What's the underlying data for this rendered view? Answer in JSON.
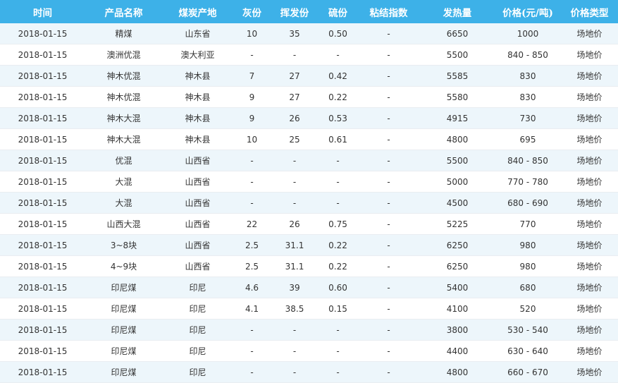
{
  "headers": [
    "时间",
    "产品名称",
    "煤炭产地",
    "灰份",
    "挥发份",
    "硫份",
    "粘结指数",
    "发热量",
    "价格(元/吨)",
    "价格类型"
  ],
  "rows": [
    [
      "2018-01-15",
      "精煤",
      "山东省",
      "10",
      "35",
      "0.50",
      "-",
      "6650",
      "1000",
      "场地价"
    ],
    [
      "2018-01-15",
      "澳洲优混",
      "澳大利亚",
      "-",
      "-",
      "-",
      "-",
      "5500",
      "840 - 850",
      "场地价"
    ],
    [
      "2018-01-15",
      "神木优混",
      "神木县",
      "7",
      "27",
      "0.42",
      "-",
      "5585",
      "830",
      "场地价"
    ],
    [
      "2018-01-15",
      "神木优混",
      "神木县",
      "9",
      "27",
      "0.22",
      "-",
      "5580",
      "830",
      "场地价"
    ],
    [
      "2018-01-15",
      "神木大混",
      "神木县",
      "9",
      "26",
      "0.53",
      "-",
      "4915",
      "730",
      "场地价"
    ],
    [
      "2018-01-15",
      "神木大混",
      "神木县",
      "10",
      "25",
      "0.61",
      "-",
      "4800",
      "695",
      "场地价"
    ],
    [
      "2018-01-15",
      "优混",
      "山西省",
      "-",
      "-",
      "-",
      "-",
      "5500",
      "840 - 850",
      "场地价"
    ],
    [
      "2018-01-15",
      "大混",
      "山西省",
      "-",
      "-",
      "-",
      "-",
      "5000",
      "770 - 780",
      "场地价"
    ],
    [
      "2018-01-15",
      "大混",
      "山西省",
      "-",
      "-",
      "-",
      "-",
      "4500",
      "680 - 690",
      "场地价"
    ],
    [
      "2018-01-15",
      "山西大混",
      "山西省",
      "22",
      "26",
      "0.75",
      "-",
      "5225",
      "770",
      "场地价"
    ],
    [
      "2018-01-15",
      "3~8块",
      "山西省",
      "2.5",
      "31.1",
      "0.22",
      "-",
      "6250",
      "980",
      "场地价"
    ],
    [
      "2018-01-15",
      "4~9块",
      "山西省",
      "2.5",
      "31.1",
      "0.22",
      "-",
      "6250",
      "980",
      "场地价"
    ],
    [
      "2018-01-15",
      "印尼煤",
      "印尼",
      "4.6",
      "39",
      "0.60",
      "-",
      "5400",
      "680",
      "场地价"
    ],
    [
      "2018-01-15",
      "印尼煤",
      "印尼",
      "4.1",
      "38.5",
      "0.15",
      "-",
      "4100",
      "520",
      "场地价"
    ],
    [
      "2018-01-15",
      "印尼煤",
      "印尼",
      "-",
      "-",
      "-",
      "-",
      "3800",
      "530 - 540",
      "场地价"
    ],
    [
      "2018-01-15",
      "印尼煤",
      "印尼",
      "-",
      "-",
      "-",
      "-",
      "4400",
      "630 - 640",
      "场地价"
    ],
    [
      "2018-01-15",
      "印尼煤",
      "印尼",
      "-",
      "-",
      "-",
      "-",
      "4800",
      "660 - 670",
      "场地价"
    ]
  ]
}
